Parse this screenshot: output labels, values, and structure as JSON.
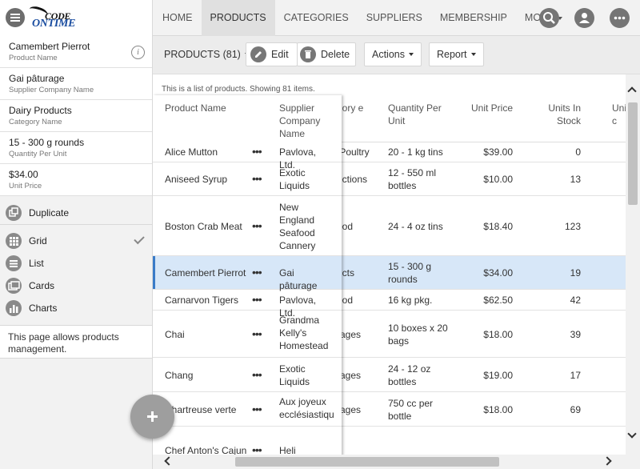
{
  "app": {
    "logo_line1": "CODE",
    "logo_line2": "ONTIME"
  },
  "nav": {
    "items": [
      "HOME",
      "PRODUCTS",
      "CATEGORIES",
      "SUPPLIERS",
      "MEMBERSHIP",
      "MORE"
    ],
    "active": "PRODUCTS"
  },
  "icons": {
    "menu": "hamburger-menu-icon",
    "search": "search-icon",
    "account": "user-icon",
    "more": "ellipsis-icon",
    "info": "info-icon",
    "duplicate": "duplicate-icon",
    "grid": "grid-icon",
    "list": "list-icon",
    "cards": "cards-icon",
    "charts": "charts-icon",
    "edit": "pencil-icon",
    "delete": "trash-icon",
    "add": "plus-icon"
  },
  "sidebar": {
    "summary": [
      {
        "value": "Camembert Pierrot",
        "label": "Product Name"
      },
      {
        "value": "Gai pâturage",
        "label": "Supplier Company Name"
      },
      {
        "value": "Dairy Products",
        "label": "Category Name"
      },
      {
        "value": "15 - 300 g rounds",
        "label": "Quantity Per Unit"
      },
      {
        "value": "$34.00",
        "label": "Unit Price"
      }
    ],
    "duplicate": "Duplicate",
    "views": [
      "Grid",
      "List",
      "Cards",
      "Charts"
    ],
    "selected_view": "Grid",
    "description": "This page allows products management."
  },
  "toolbar": {
    "view_label": "PRODUCTS (81)",
    "edit": "Edit",
    "delete": "Delete",
    "actions": "Actions",
    "report": "Report"
  },
  "grid": {
    "info": "This is a list of products. Showing 81 items.",
    "headers": {
      "product": "Product Name",
      "supplier": "Supplier Company Name",
      "category": "gory e",
      "qty": "Quantity Per Unit",
      "price": "Unit Price",
      "stock": "Units In Stock",
      "uni": "Uni c"
    },
    "rows": [
      {
        "product": "Alice Mutton",
        "supplier": "Pavlova, Ltd.",
        "category": "/Poultry",
        "qty": "20 - 1 kg tins",
        "price": "$39.00",
        "stock": "0"
      },
      {
        "product": "Aniseed Syrup",
        "supplier": "Exotic Liquids",
        "category": "ections",
        "qty": "12 - 550 ml bottles",
        "price": "$10.00",
        "stock": "13"
      },
      {
        "product": "Boston Crab Meat",
        "supplier": "New England Seafood Cannery",
        "category": "ood",
        "qty": "24 - 4 oz tins",
        "price": "$18.40",
        "stock": "123"
      },
      {
        "product": "Camembert Pierrot",
        "supplier": "Gai pâturage",
        "category": "ucts",
        "qty": "15 - 300 g rounds",
        "price": "$34.00",
        "stock": "19",
        "selected": true
      },
      {
        "product": "Carnarvon Tigers",
        "supplier": "Pavlova, Ltd.",
        "category": "ood",
        "qty": "16 kg pkg.",
        "price": "$62.50",
        "stock": "42"
      },
      {
        "product": "Chai",
        "supplier": "Grandma Kelly's Homestead",
        "category": "rages",
        "qty": "10 boxes x 20 bags",
        "price": "$18.00",
        "stock": "39"
      },
      {
        "product": "Chang",
        "supplier": "Exotic Liquids",
        "category": "rages",
        "qty": "24 - 12 oz bottles",
        "price": "$19.00",
        "stock": "17"
      },
      {
        "product": "Chartreuse verte",
        "supplier": "Aux joyeux ecclésiastiques",
        "category": "rages",
        "qty": "750 cc per bottle",
        "price": "$18.00",
        "stock": "69"
      },
      {
        "product": "Chef Anton's Cajun",
        "supplier": "Heli Süßwaren",
        "category": "",
        "qty": "",
        "price": "",
        "stock": ""
      }
    ],
    "row_menu": "•••"
  }
}
